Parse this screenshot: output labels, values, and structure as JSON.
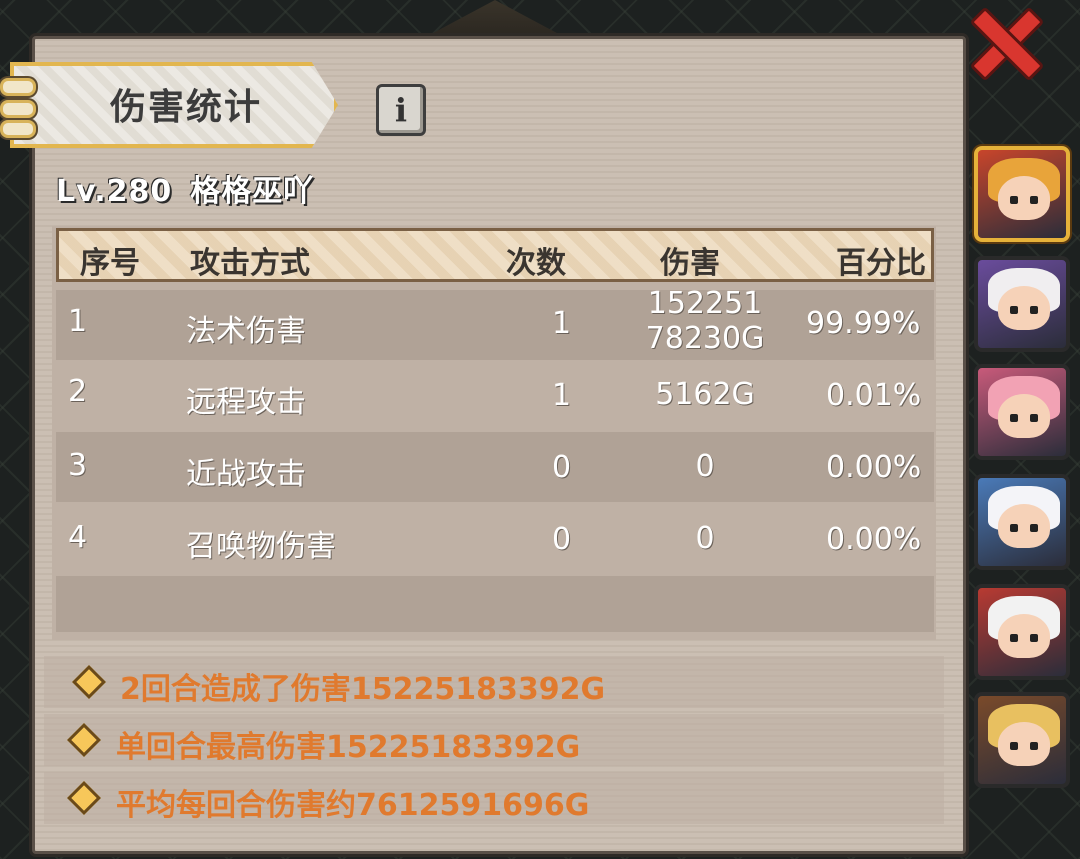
{
  "panel": {
    "title": "伤害统计",
    "info_icon": "i",
    "player_level": "Lv.280",
    "player_name": "格格巫吖"
  },
  "table": {
    "headers": [
      "序号",
      "攻击方式",
      "次数",
      "伤害",
      "百分比"
    ],
    "rows": [
      {
        "index": "1",
        "type": "法术伤害",
        "count": "1",
        "damage_line1": "152251",
        "damage_line2": "78230G",
        "percent": "99.99%"
      },
      {
        "index": "2",
        "type": "远程攻击",
        "count": "1",
        "damage_line1": "5162G",
        "damage_line2": "",
        "percent": "0.01%"
      },
      {
        "index": "3",
        "type": "近战攻击",
        "count": "0",
        "damage_line1": "0",
        "damage_line2": "",
        "percent": "0.00%"
      },
      {
        "index": "4",
        "type": "召唤物伤害",
        "count": "0",
        "damage_line1": "0",
        "damage_line2": "",
        "percent": "0.00%"
      }
    ]
  },
  "summary": [
    "2回合造成了伤害15225183392G",
    "单回合最高伤害15225183392G",
    "平均每回合伤害约7612591696G"
  ],
  "icons": {
    "close": "close-icon",
    "info": "info-icon",
    "bullet": "diamond-bullet-icon"
  },
  "heroes": [
    {
      "name": "hero-warrior",
      "hair": "#e8a43a",
      "bg": "#c8452b",
      "active": true
    },
    {
      "name": "hero-white-hair-mage",
      "hair": "#f0eef0",
      "bg": "#6a4c9c",
      "active": false
    },
    {
      "name": "hero-pink-hair-nurse",
      "hair": "#f2a2b4",
      "bg": "#c85a7a",
      "active": false
    },
    {
      "name": "hero-white-braid",
      "hair": "#f4f4f8",
      "bg": "#4a7ab8",
      "active": false
    },
    {
      "name": "hero-white-hair-red",
      "hair": "#f2f2f2",
      "bg": "#b83a32",
      "active": false
    },
    {
      "name": "hero-blonde-armor",
      "hair": "#e8c060",
      "bg": "#7a4a2a",
      "active": false
    }
  ],
  "colors": {
    "summary_text": "#e07a2e",
    "title_border": "#e2b64f",
    "close_red": "#d9362f"
  }
}
